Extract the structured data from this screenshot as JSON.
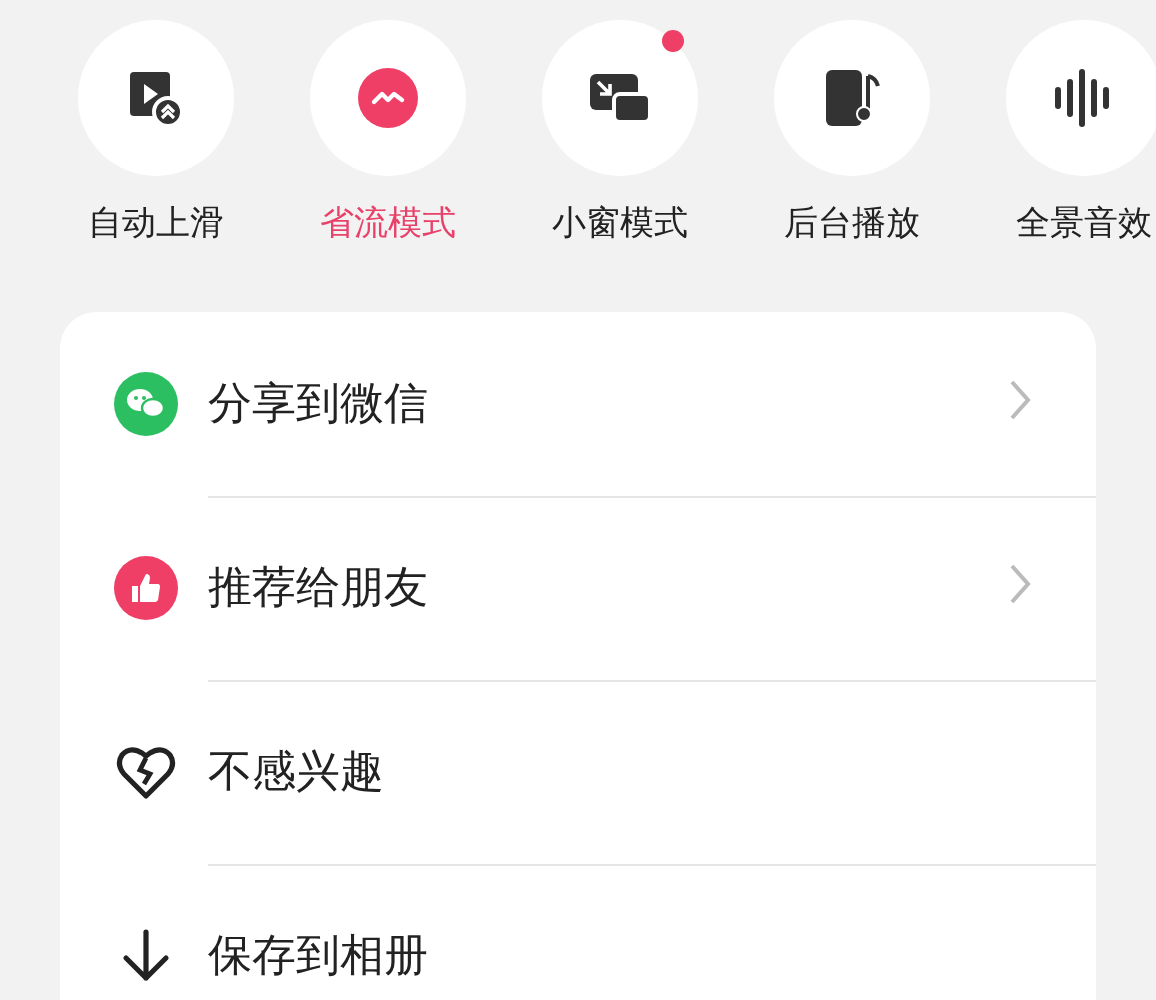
{
  "quick_actions": [
    {
      "label": "自动上滑",
      "selected": false,
      "badge": false
    },
    {
      "label": "省流模式",
      "selected": true,
      "badge": false
    },
    {
      "label": "小窗模式",
      "selected": false,
      "badge": true
    },
    {
      "label": "后台播放",
      "selected": false,
      "badge": false
    },
    {
      "label": "全景音效",
      "selected": false,
      "badge": false
    }
  ],
  "menu": [
    {
      "label": "分享到微信",
      "chevron": true
    },
    {
      "label": "推荐给朋友",
      "chevron": true
    },
    {
      "label": "不感兴趣",
      "chevron": false
    },
    {
      "label": "保存到相册",
      "chevron": false
    }
  ]
}
